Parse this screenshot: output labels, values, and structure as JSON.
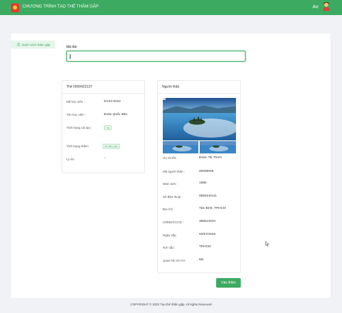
{
  "header": {
    "title": "CHƯƠNG TRÌNH TẠO THẺ THĂM GẶP",
    "user_name": "An",
    "accent": "#3daa62"
  },
  "sidebar": {
    "items": [
      {
        "label": "Danh sách thăm gặp",
        "icon": "user-icon",
        "active": true
      }
    ]
  },
  "search": {
    "label": "Mã thẻ",
    "value": "",
    "placeholder": ""
  },
  "card_left": {
    "title": "Thẻ 0000422137",
    "rows": [
      {
        "label": "Mã học viên :",
        "value": "DV22-0234"
      },
      {
        "label": "Tên học viên :",
        "value": "Đoàn Quốc Bảo"
      },
      {
        "label": "Tình trạng cải tạo :",
        "tag": "Tốt"
      },
      {
        "label": "Tình trạng thăm:",
        "tag": "Đủ điều kiện"
      },
      {
        "label": "Lý do:",
        "value": "--"
      }
    ]
  },
  "card_right": {
    "title": "Người thân",
    "rows": [
      {
        "label": "Họ và tên:",
        "value": "Đoàn Thị Thơm"
      },
      {
        "label": "Mã người thân :",
        "value": "00000005"
      },
      {
        "label": "Năm sinh :",
        "value": "1986"
      },
      {
        "label": "Số điện thoại :",
        "value": "0856444111"
      },
      {
        "label": "Địa chỉ:",
        "value": "Tân Bình, TPHCM"
      },
      {
        "label": "CMND/CCCD :",
        "value": "385812033"
      },
      {
        "label": "Ngày cấp:",
        "value": "03/07/2019"
      },
      {
        "label": "Nơi cấp :",
        "value": "TPHCM"
      },
      {
        "label": "Quan hệ với HV:",
        "value": "Mẹ"
      }
    ]
  },
  "actions": {
    "visit_label": "Vào thăm"
  },
  "footer": {
    "text": "COPYRIGHT © 2022 Tạo thẻ thăm gặp, All rights Reserved"
  }
}
